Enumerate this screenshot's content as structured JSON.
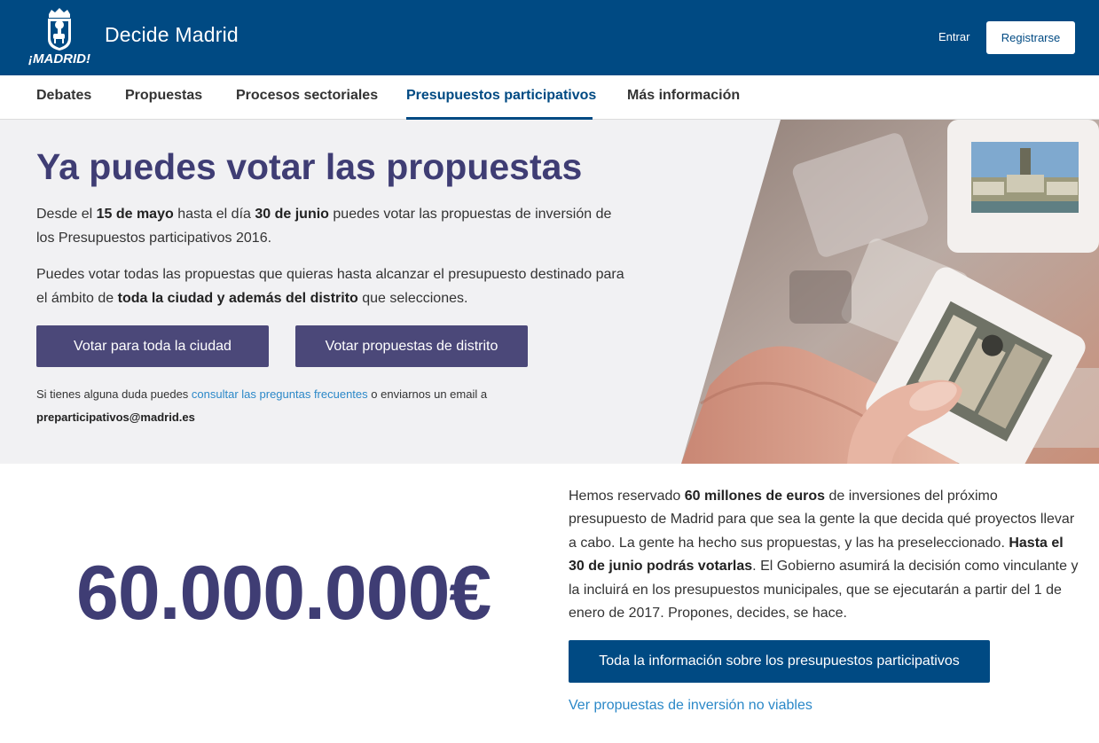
{
  "header": {
    "brand": "Decide Madrid",
    "logo_text": "¡MADRID!",
    "login_label": "Entrar",
    "register_label": "Registrarse"
  },
  "nav": {
    "items": [
      {
        "label": "Debates"
      },
      {
        "label": "Propuestas"
      },
      {
        "label": "Procesos sectoriales"
      },
      {
        "label": "Presupuestos participativos",
        "active": true
      },
      {
        "label": "Más información"
      }
    ]
  },
  "hero": {
    "title": "Ya puedes votar las propuestas",
    "p1": {
      "t1": "Desde el ",
      "b1": "15 de mayo",
      "t2": " hasta el día ",
      "b2": "30 de junio",
      "t3": " puedes votar las propuestas de inversión de los Presupuestos participativos 2016."
    },
    "p2": {
      "t1": "Puedes votar todas las propuestas que quieras hasta alcanzar el presupuesto destinado para el ámbito de ",
      "b1": "toda la ciudad y además del distrito",
      "t2": " que selecciones."
    },
    "buttons": {
      "city": "Votar para toda la ciudad",
      "district": "Votar propuestas de distrito"
    },
    "help": {
      "t1": "Si tienes alguna duda puedes ",
      "link": "consultar las preguntas frecuentes",
      "t2": " o enviarnos un email a",
      "email": "preparticipativos@madrid.es"
    }
  },
  "budget": {
    "amount": "60.000.000€",
    "text": {
      "t1": "Hemos reservado ",
      "b1": "60 millones de euros",
      "t2": " de inversiones del próximo presupuesto de Madrid para que sea la gente la que decida qué proyectos llevar a cabo. La gente ha hecho sus propuestas, y las ha preseleccionado. ",
      "b2": "Hasta el 30 de junio podrás votarlas",
      "t3": ". El Gobierno asumirá la decisión como vinculante y la incluirá en los presupuestos municipales, que se ejecutarán a partir del 1 de enero de 2017. Propones, decides, se hace."
    },
    "info_button": "Toda la información sobre los presupuestos participativos",
    "nonviable_link": "Ver propuestas de inversión no viables"
  },
  "colors": {
    "header_bg": "#004a83",
    "title_purple": "#3f3d74",
    "vote_button": "#4b4879",
    "link_blue": "#2b88c8"
  }
}
